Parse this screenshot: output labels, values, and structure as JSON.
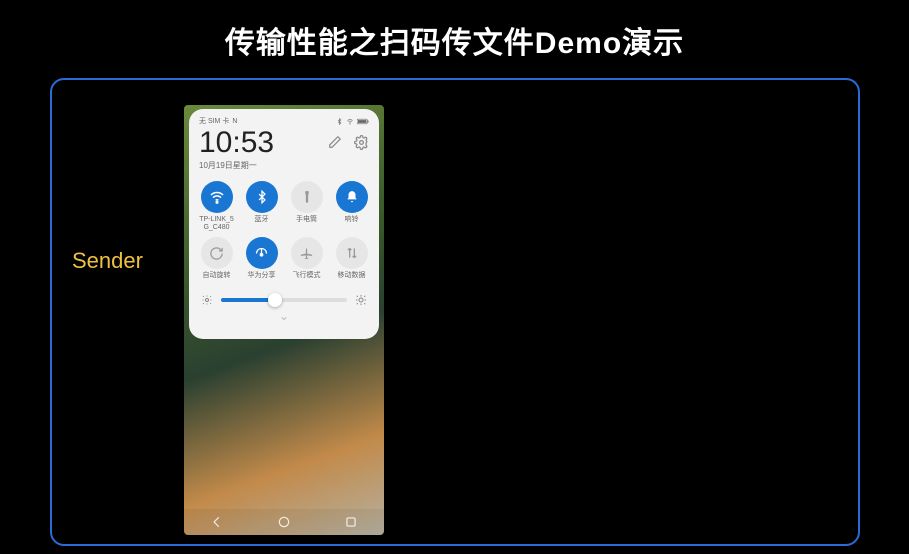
{
  "title": "传输性能之扫码传文件Demo演示",
  "sender_label": "Sender",
  "statusbar": {
    "sim": "无 SIM 卡",
    "nfc": "N"
  },
  "time": "10:53",
  "date": "10月19日星期一",
  "tiles": [
    {
      "label": "TP-LINK_5G_C480",
      "on": true,
      "icon": "wifi"
    },
    {
      "label": "蓝牙",
      "on": true,
      "icon": "bluetooth"
    },
    {
      "label": "手电筒",
      "on": false,
      "icon": "flashlight"
    },
    {
      "label": "响铃",
      "on": true,
      "icon": "bell"
    },
    {
      "label": "自动旋转",
      "on": false,
      "icon": "rotate"
    },
    {
      "label": "华为分享",
      "on": true,
      "icon": "share"
    },
    {
      "label": "飞行模式",
      "on": false,
      "icon": "airplane"
    },
    {
      "label": "移动数据",
      "on": false,
      "icon": "data"
    }
  ],
  "brightness_pct": 43
}
